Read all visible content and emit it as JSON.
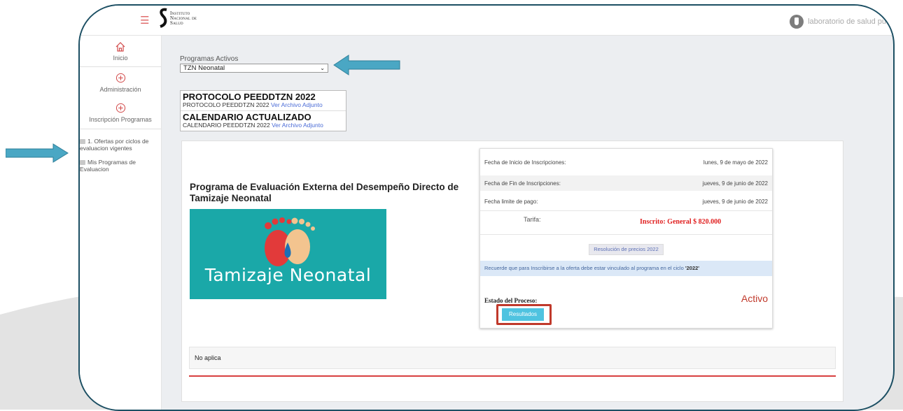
{
  "header": {
    "logo_lines": [
      "Instituto",
      "Nacional de",
      "Salud"
    ],
    "user_name": "laboratorio de salud pu"
  },
  "sidebar": {
    "items": [
      {
        "label": "Inicio",
        "icon": "home-icon"
      },
      {
        "label": "Administración",
        "icon": "plus-circle-icon"
      },
      {
        "label": "Inscripción Programas",
        "icon": "plus-circle-icon"
      }
    ],
    "links": [
      {
        "label": "1. Ofertas por ciclos de evaluacion vigentes"
      },
      {
        "label": "Mis Programas de Evaluacion"
      }
    ]
  },
  "programs": {
    "label": "Programas Activos",
    "selected": "TZN Neonatal"
  },
  "documents": [
    {
      "title": "PROTOCOLO PEEDDTZN 2022",
      "subtitle": "PROTOCOLO PEEDDTZN 2022",
      "link": "Ver Archivo Adjunto"
    },
    {
      "title": "CALENDARIO ACTUALIZADO",
      "subtitle": "CALENDARIO PEEDDTZN 2022",
      "link": "Ver Archivo Adjunto"
    }
  ],
  "program": {
    "title": "Programa de Evaluación Externa del Desempeño Directo de Tamizaje Neonatal",
    "banner_text": "Tamizaje Neonatal"
  },
  "details": {
    "rows": [
      {
        "label": "Fecha de Inicio de Inscripciones:",
        "value": "lunes, 9 de mayo de 2022"
      },
      {
        "label": "Fecha de Fin de Inscripciones:",
        "value": "jueves, 9 de junio de 2022"
      },
      {
        "label": "Fecha limite de pago:",
        "value": "jueves, 9 de junio de 2022"
      }
    ],
    "tarifa_label": "Tarifa:",
    "tarifa_value": "Inscrito: General $ 820.000",
    "resolution_button": "Resolución de precios 2022",
    "notice_text": "Recuerde que para Inscribirse a la oferta debe estar vinculado al programa en el ciclo ",
    "notice_cycle": "'2022'",
    "estado_label": "Estado del Proceso:",
    "estado_value": "Activo",
    "results_button": "Resultados"
  },
  "footer_row": "No aplica",
  "colors": {
    "accent_red": "#d24a4a",
    "frame_border": "#1c4f63",
    "arrow_blue": "#4aa7c4",
    "results_button": "#4fc3e0",
    "banner_teal": "#1aa8a8"
  }
}
